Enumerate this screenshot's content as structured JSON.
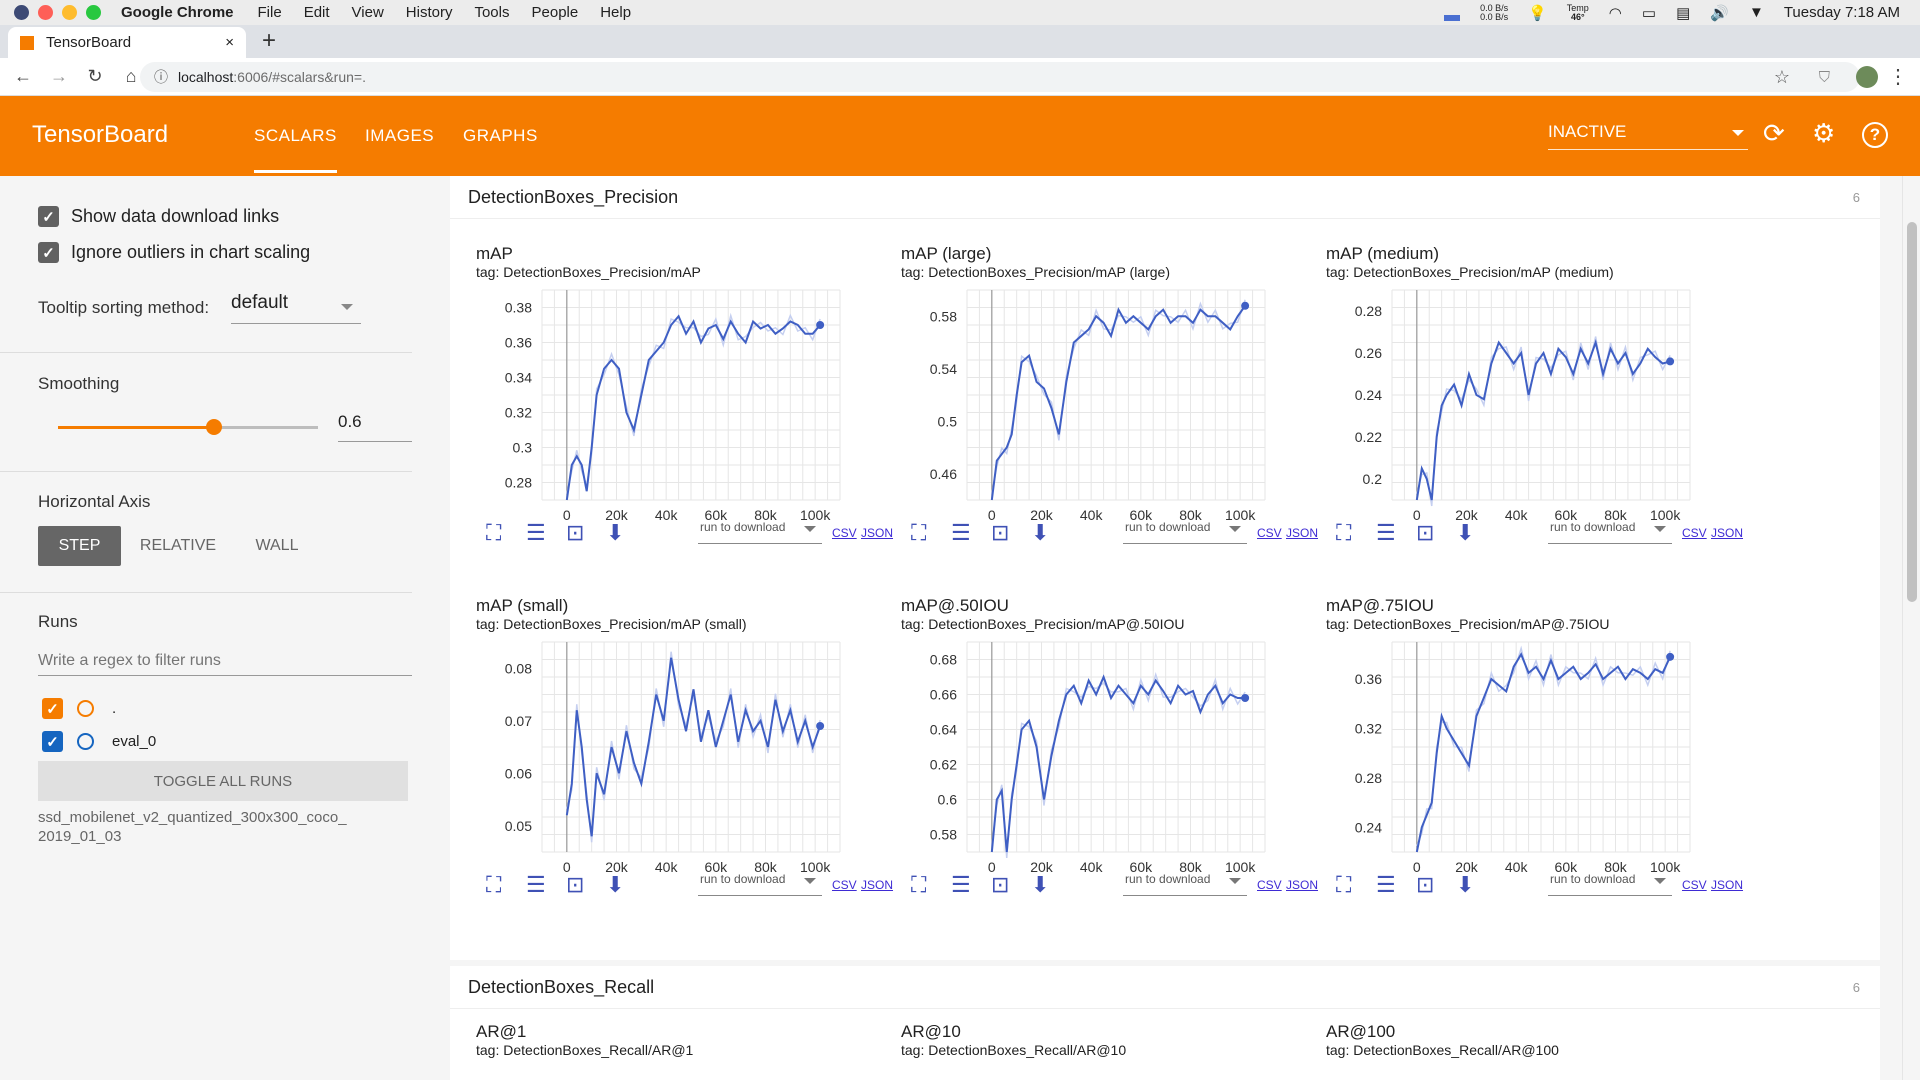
{
  "menubar": {
    "app_name": "Google Chrome",
    "items": [
      "File",
      "Edit",
      "View",
      "History",
      "Tools",
      "People",
      "Help"
    ],
    "net_up": "0.0 B/s",
    "net_down": "0.0 B/s",
    "temp_label": "Temp",
    "temp_value": "46°",
    "clock": "Tuesday 7:18 AM"
  },
  "browser": {
    "tab_title": "TensorBoard",
    "tab_close": "×",
    "new_tab": "+",
    "url_host": "localhost",
    "url_rest": ":6006/#scalars&run=."
  },
  "header": {
    "title": "TensorBoard",
    "tabs": [
      {
        "label": "SCALARS",
        "active": true
      },
      {
        "label": "IMAGES",
        "active": false
      },
      {
        "label": "GRAPHS",
        "active": false
      }
    ],
    "run_status": "INACTIVE",
    "accent": "#f57c00"
  },
  "sidebar": {
    "show_download_links": {
      "label": "Show data download links",
      "checked": true
    },
    "ignore_outliers": {
      "label": "Ignore outliers in chart scaling",
      "checked": true
    },
    "tooltip_label": "Tooltip sorting method:",
    "tooltip_value": "default",
    "smoothing_label": "Smoothing",
    "smoothing_value": "0.6",
    "smoothing_fraction": 0.6,
    "horizontal_axis_label": "Horizontal Axis",
    "axis_options": [
      "STEP",
      "RELATIVE",
      "WALL"
    ],
    "axis_selected": "STEP",
    "runs_label": "Runs",
    "runs_filter_placeholder": "Write a regex to filter runs",
    "runs": [
      {
        "name": ".",
        "checked": true,
        "color": "#f57c00"
      },
      {
        "name": "eval_0",
        "checked": true,
        "color": "#1565c0"
      }
    ],
    "toggle_all": "TOGGLE ALL RUNS",
    "logdir_line1": "ssd_mobilenet_v2_quantized_300x300_coco_",
    "logdir_line2": "2019_01_03"
  },
  "sections": [
    {
      "title": "DetectionBoxes_Precision",
      "count": "6"
    },
    {
      "title": "DetectionBoxes_Recall",
      "count": "6"
    }
  ],
  "chart_tools": {
    "run_to_download": "run to download",
    "csv": "CSV",
    "json": "JSON"
  },
  "recall_charts": [
    {
      "title": "AR@1",
      "tag": "tag: DetectionBoxes_Recall/AR@1"
    },
    {
      "title": "AR@10",
      "tag": "tag: DetectionBoxes_Recall/AR@10"
    },
    {
      "title": "AR@100",
      "tag": "tag: DetectionBoxes_Recall/AR@100"
    }
  ],
  "chart_data": [
    {
      "type": "line",
      "title": "mAP",
      "tag": "tag: DetectionBoxes_Precision/mAP",
      "xticks": [
        "0",
        "20k",
        "40k",
        "60k",
        "80k",
        "100k"
      ],
      "xlim": [
        -10000,
        110000
      ],
      "yticks": [
        "0.28",
        "0.3",
        "0.32",
        "0.34",
        "0.36",
        "0.38"
      ],
      "ylim": [
        0.27,
        0.39
      ],
      "color": "#3f5fc4",
      "x": [
        0,
        2000,
        4000,
        6000,
        8000,
        10000,
        12000,
        15000,
        18000,
        21000,
        24000,
        27000,
        30000,
        33000,
        36000,
        39000,
        42000,
        45000,
        48000,
        51000,
        54000,
        57000,
        60000,
        63000,
        66000,
        69000,
        72000,
        75000,
        78000,
        81000,
        84000,
        87000,
        90000,
        93000,
        96000,
        99000,
        102000
      ],
      "y": [
        0.27,
        0.29,
        0.295,
        0.29,
        0.275,
        0.3,
        0.33,
        0.345,
        0.35,
        0.345,
        0.32,
        0.31,
        0.33,
        0.35,
        0.355,
        0.36,
        0.37,
        0.375,
        0.365,
        0.372,
        0.36,
        0.368,
        0.37,
        0.362,
        0.372,
        0.365,
        0.36,
        0.372,
        0.368,
        0.37,
        0.365,
        0.368,
        0.372,
        0.37,
        0.365,
        0.365,
        0.37
      ]
    },
    {
      "type": "line",
      "title": "mAP (large)",
      "tag": "tag: DetectionBoxes_Precision/mAP (large)",
      "xticks": [
        "0",
        "20k",
        "40k",
        "60k",
        "80k",
        "100k"
      ],
      "xlim": [
        -10000,
        110000
      ],
      "yticks": [
        "0.46",
        "0.5",
        "0.54",
        "0.58"
      ],
      "ylim": [
        0.44,
        0.6
      ],
      "color": "#3f5fc4",
      "x": [
        0,
        2000,
        4000,
        6000,
        8000,
        10000,
        12000,
        15000,
        18000,
        21000,
        24000,
        27000,
        30000,
        33000,
        36000,
        39000,
        42000,
        45000,
        48000,
        51000,
        54000,
        57000,
        60000,
        63000,
        66000,
        69000,
        72000,
        75000,
        78000,
        81000,
        84000,
        87000,
        90000,
        93000,
        96000,
        99000,
        102000
      ],
      "y": [
        0.44,
        0.47,
        0.475,
        0.48,
        0.49,
        0.52,
        0.545,
        0.55,
        0.53,
        0.525,
        0.51,
        0.49,
        0.53,
        0.56,
        0.565,
        0.57,
        0.58,
        0.575,
        0.565,
        0.585,
        0.575,
        0.58,
        0.575,
        0.57,
        0.58,
        0.585,
        0.575,
        0.58,
        0.58,
        0.575,
        0.585,
        0.58,
        0.58,
        0.575,
        0.57,
        0.58,
        0.588
      ]
    },
    {
      "type": "line",
      "title": "mAP (medium)",
      "tag": "tag: DetectionBoxes_Precision/mAP (medium)",
      "xticks": [
        "0",
        "20k",
        "40k",
        "60k",
        "80k",
        "100k"
      ],
      "xlim": [
        -10000,
        110000
      ],
      "yticks": [
        "0.2",
        "0.22",
        "0.24",
        "0.26",
        "0.28"
      ],
      "ylim": [
        0.19,
        0.29
      ],
      "color": "#3f5fc4",
      "x": [
        0,
        2000,
        4000,
        6000,
        8000,
        10000,
        12000,
        15000,
        18000,
        21000,
        24000,
        27000,
        30000,
        33000,
        36000,
        39000,
        42000,
        45000,
        48000,
        51000,
        54000,
        57000,
        60000,
        63000,
        66000,
        69000,
        72000,
        75000,
        78000,
        81000,
        84000,
        87000,
        90000,
        93000,
        96000,
        99000,
        102000
      ],
      "y": [
        0.19,
        0.205,
        0.2,
        0.19,
        0.22,
        0.235,
        0.24,
        0.245,
        0.235,
        0.25,
        0.24,
        0.238,
        0.255,
        0.265,
        0.26,
        0.255,
        0.26,
        0.24,
        0.255,
        0.26,
        0.25,
        0.262,
        0.258,
        0.25,
        0.262,
        0.255,
        0.265,
        0.25,
        0.262,
        0.255,
        0.26,
        0.25,
        0.255,
        0.262,
        0.258,
        0.255,
        0.256
      ]
    },
    {
      "type": "line",
      "title": "mAP (small)",
      "tag": "tag: DetectionBoxes_Precision/mAP (small)",
      "xticks": [
        "0",
        "20k",
        "40k",
        "60k",
        "80k",
        "100k"
      ],
      "xlim": [
        -10000,
        110000
      ],
      "yticks": [
        "0.05",
        "0.06",
        "0.07",
        "0.08"
      ],
      "ylim": [
        0.045,
        0.085
      ],
      "color": "#3f5fc4",
      "x": [
        0,
        2000,
        4000,
        6000,
        8000,
        10000,
        12000,
        15000,
        18000,
        21000,
        24000,
        27000,
        30000,
        33000,
        36000,
        39000,
        42000,
        45000,
        48000,
        51000,
        54000,
        57000,
        60000,
        63000,
        66000,
        69000,
        72000,
        75000,
        78000,
        81000,
        84000,
        87000,
        90000,
        93000,
        96000,
        99000,
        102000
      ],
      "y": [
        0.052,
        0.058,
        0.072,
        0.065,
        0.055,
        0.048,
        0.06,
        0.056,
        0.065,
        0.06,
        0.068,
        0.062,
        0.058,
        0.066,
        0.075,
        0.07,
        0.082,
        0.074,
        0.068,
        0.076,
        0.066,
        0.072,
        0.065,
        0.07,
        0.075,
        0.066,
        0.072,
        0.068,
        0.07,
        0.065,
        0.074,
        0.068,
        0.072,
        0.066,
        0.07,
        0.065,
        0.069
      ]
    },
    {
      "type": "line",
      "title": "mAP@.50IOU",
      "tag": "tag: DetectionBoxes_Precision/mAP@.50IOU",
      "xticks": [
        "0",
        "20k",
        "40k",
        "60k",
        "80k",
        "100k"
      ],
      "xlim": [
        -10000,
        110000
      ],
      "yticks": [
        "0.58",
        "0.6",
        "0.62",
        "0.64",
        "0.66",
        "0.68"
      ],
      "ylim": [
        0.57,
        0.69
      ],
      "color": "#3f5fc4",
      "x": [
        0,
        2000,
        4000,
        6000,
        8000,
        10000,
        12000,
        15000,
        18000,
        21000,
        24000,
        27000,
        30000,
        33000,
        36000,
        39000,
        42000,
        45000,
        48000,
        51000,
        54000,
        57000,
        60000,
        63000,
        66000,
        69000,
        72000,
        75000,
        78000,
        81000,
        84000,
        87000,
        90000,
        93000,
        96000,
        99000,
        102000
      ],
      "y": [
        0.57,
        0.6,
        0.605,
        0.57,
        0.6,
        0.62,
        0.64,
        0.645,
        0.63,
        0.6,
        0.625,
        0.645,
        0.66,
        0.665,
        0.655,
        0.668,
        0.66,
        0.67,
        0.658,
        0.665,
        0.66,
        0.655,
        0.665,
        0.66,
        0.668,
        0.662,
        0.655,
        0.665,
        0.66,
        0.662,
        0.65,
        0.66,
        0.665,
        0.655,
        0.66,
        0.658,
        0.658
      ]
    },
    {
      "type": "line",
      "title": "mAP@.75IOU",
      "tag": "tag: DetectionBoxes_Precision/mAP@.75IOU",
      "xticks": [
        "0",
        "20k",
        "40k",
        "60k",
        "80k",
        "100k"
      ],
      "xlim": [
        -10000,
        110000
      ],
      "yticks": [
        "0.24",
        "0.28",
        "0.32",
        "0.36"
      ],
      "ylim": [
        0.22,
        0.39
      ],
      "color": "#3f5fc4",
      "x": [
        0,
        2000,
        4000,
        6000,
        8000,
        10000,
        12000,
        15000,
        18000,
        21000,
        24000,
        27000,
        30000,
        33000,
        36000,
        39000,
        42000,
        45000,
        48000,
        51000,
        54000,
        57000,
        60000,
        63000,
        66000,
        69000,
        72000,
        75000,
        78000,
        81000,
        84000,
        87000,
        90000,
        93000,
        96000,
        99000,
        102000
      ],
      "y": [
        0.22,
        0.24,
        0.25,
        0.26,
        0.3,
        0.33,
        0.32,
        0.31,
        0.3,
        0.29,
        0.33,
        0.345,
        0.36,
        0.355,
        0.35,
        0.37,
        0.38,
        0.365,
        0.37,
        0.36,
        0.375,
        0.36,
        0.365,
        0.37,
        0.36,
        0.365,
        0.372,
        0.36,
        0.365,
        0.37,
        0.36,
        0.368,
        0.365,
        0.36,
        0.368,
        0.365,
        0.378
      ]
    }
  ]
}
